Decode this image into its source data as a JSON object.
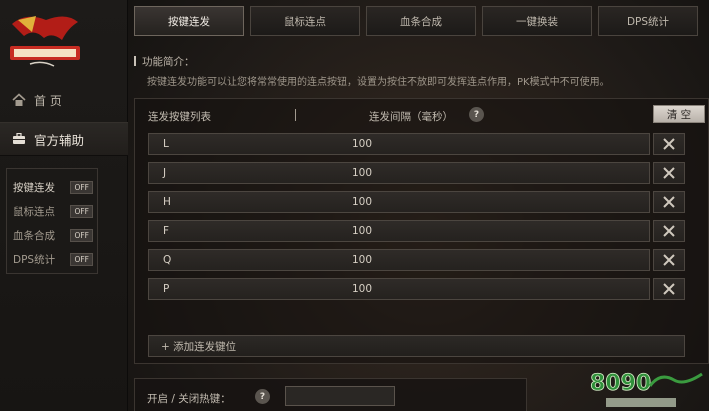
{
  "sidebar": {
    "nav_home": "首 页",
    "nav_helper": "官方辅助",
    "sub_items": [
      {
        "label": "按键连发",
        "badge": "OFF"
      },
      {
        "label": "鼠标连点",
        "badge": "OFF"
      },
      {
        "label": "血条合成",
        "badge": "OFF"
      },
      {
        "label": "DPS统计",
        "badge": "OFF"
      }
    ]
  },
  "tabs": [
    {
      "label": "按键连发",
      "active": true
    },
    {
      "label": "鼠标连点",
      "active": false
    },
    {
      "label": "血条合成",
      "active": false
    },
    {
      "label": "一键换装",
      "active": false
    },
    {
      "label": "DPS统计",
      "active": false
    }
  ],
  "intro": {
    "title": "功能简介：",
    "text": "按键连发功能可以让您将常常使用的连点按钮，设置为按住不放即可发挥连点作用，PK模式中不可使用。"
  },
  "key_list": {
    "header_list": "连发按键列表",
    "header_separator": "|",
    "header_interval": "连发间隔（毫秒）",
    "help": "?",
    "clear_label": "清 空",
    "rows": [
      {
        "key": "L",
        "interval": "100"
      },
      {
        "key": "J",
        "interval": "100"
      },
      {
        "key": "H",
        "interval": "100"
      },
      {
        "key": "F",
        "interval": "100"
      },
      {
        "key": "Q",
        "interval": "100"
      },
      {
        "key": "P",
        "interval": "100"
      }
    ],
    "add_label": "+ 添加连发键位"
  },
  "hotkey": {
    "label": "开启 / 关闭热键：",
    "help": "?",
    "value": ""
  },
  "colors": {
    "accent_red": "#c8241c",
    "badge_bg": "#3a3633",
    "clear_btn_bg": "#cfc8c0"
  }
}
